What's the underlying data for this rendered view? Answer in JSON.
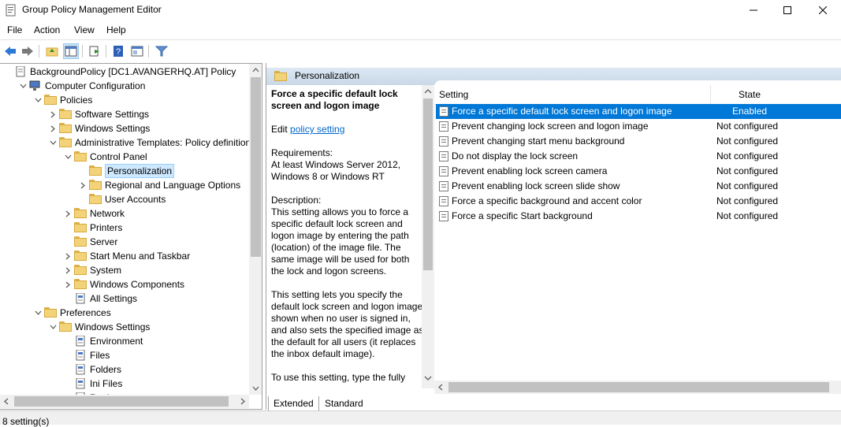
{
  "window": {
    "title": "Group Policy Management Editor"
  },
  "menu": [
    "File",
    "Action",
    "View",
    "Help"
  ],
  "tree": [
    {
      "label": "BackgroundPolicy [DC1.AVANGERHQ.AT] Policy",
      "indent": 0,
      "chev": "",
      "icon": "policy-icon"
    },
    {
      "label": "Computer Configuration",
      "indent": 1,
      "chev": "v",
      "icon": "computer-icon"
    },
    {
      "label": "Policies",
      "indent": 2,
      "chev": "v",
      "icon": "folder-icon"
    },
    {
      "label": "Software Settings",
      "indent": 3,
      "chev": ">",
      "icon": "folder-icon"
    },
    {
      "label": "Windows Settings",
      "indent": 3,
      "chev": ">",
      "icon": "folder-icon"
    },
    {
      "label": "Administrative Templates: Policy definitions",
      "indent": 3,
      "chev": "v",
      "icon": "folder-icon"
    },
    {
      "label": "Control Panel",
      "indent": 4,
      "chev": "v",
      "icon": "folder-icon"
    },
    {
      "label": "Personalization",
      "indent": 5,
      "chev": "",
      "icon": "folder-icon",
      "selected": true
    },
    {
      "label": "Regional and Language Options",
      "indent": 5,
      "chev": ">",
      "icon": "folder-icon"
    },
    {
      "label": "User Accounts",
      "indent": 5,
      "chev": "",
      "icon": "folder-icon"
    },
    {
      "label": "Network",
      "indent": 4,
      "chev": ">",
      "icon": "folder-icon"
    },
    {
      "label": "Printers",
      "indent": 4,
      "chev": "",
      "icon": "folder-icon"
    },
    {
      "label": "Server",
      "indent": 4,
      "chev": "",
      "icon": "folder-icon"
    },
    {
      "label": "Start Menu and Taskbar",
      "indent": 4,
      "chev": ">",
      "icon": "folder-icon"
    },
    {
      "label": "System",
      "indent": 4,
      "chev": ">",
      "icon": "folder-icon"
    },
    {
      "label": "Windows Components",
      "indent": 4,
      "chev": ">",
      "icon": "folder-icon"
    },
    {
      "label": "All Settings",
      "indent": 4,
      "chev": "",
      "icon": "settings-icon"
    },
    {
      "label": "Preferences",
      "indent": 2,
      "chev": "v",
      "icon": "folder-icon"
    },
    {
      "label": "Windows Settings",
      "indent": 3,
      "chev": "v",
      "icon": "folder-icon"
    },
    {
      "label": "Environment",
      "indent": 4,
      "chev": "",
      "icon": "environment-icon"
    },
    {
      "label": "Files",
      "indent": 4,
      "chev": "",
      "icon": "files-icon"
    },
    {
      "label": "Folders",
      "indent": 4,
      "chev": "",
      "icon": "folders-icon"
    },
    {
      "label": "Ini Files",
      "indent": 4,
      "chev": "",
      "icon": "ini-files-icon"
    },
    {
      "label": "Registry",
      "indent": 4,
      "chev": ">",
      "icon": "registry-icon"
    }
  ],
  "header": {
    "label": "Personalization"
  },
  "description": {
    "title": "Force a specific default lock screen and logon image",
    "edit_prefix": "Edit ",
    "edit_link": "policy setting ",
    "requirements_label": "Requirements:",
    "requirements_text": "At least Windows Server 2012, Windows 8 or Windows RT",
    "description_label": "Description:",
    "para1": "This setting allows you to force a specific default lock screen and logon image by entering the path (location) of the image file. The same image will be used for both the lock and logon screens.",
    "para2": "This setting lets you specify the default lock screen and logon image shown when no user is signed in, and also sets the specified image as the default for all users (it replaces the inbox default image).",
    "para3": "To use this setting, type the fully"
  },
  "list": {
    "col_setting": "Setting",
    "col_state": "State",
    "rows": [
      {
        "name": "Force a specific default lock screen and logon image",
        "state": "Enabled",
        "selected": true
      },
      {
        "name": "Prevent changing lock screen and logon image",
        "state": "Not configured"
      },
      {
        "name": "Prevent changing start menu background",
        "state": "Not configured"
      },
      {
        "name": "Do not display the lock screen",
        "state": "Not configured"
      },
      {
        "name": "Prevent enabling lock screen camera",
        "state": "Not configured"
      },
      {
        "name": "Prevent enabling lock screen slide show",
        "state": "Not configured"
      },
      {
        "name": "Force a specific background and accent color",
        "state": "Not configured"
      },
      {
        "name": "Force a specific Start background",
        "state": "Not configured"
      }
    ]
  },
  "tabs": [
    "Extended",
    "Standard"
  ],
  "status": {
    "text": "8 setting(s)"
  },
  "colors": {
    "selection": "#0078d7",
    "tree_selection": "#cde8ff",
    "header": "#c9d8e8",
    "link": "#0066cc"
  }
}
